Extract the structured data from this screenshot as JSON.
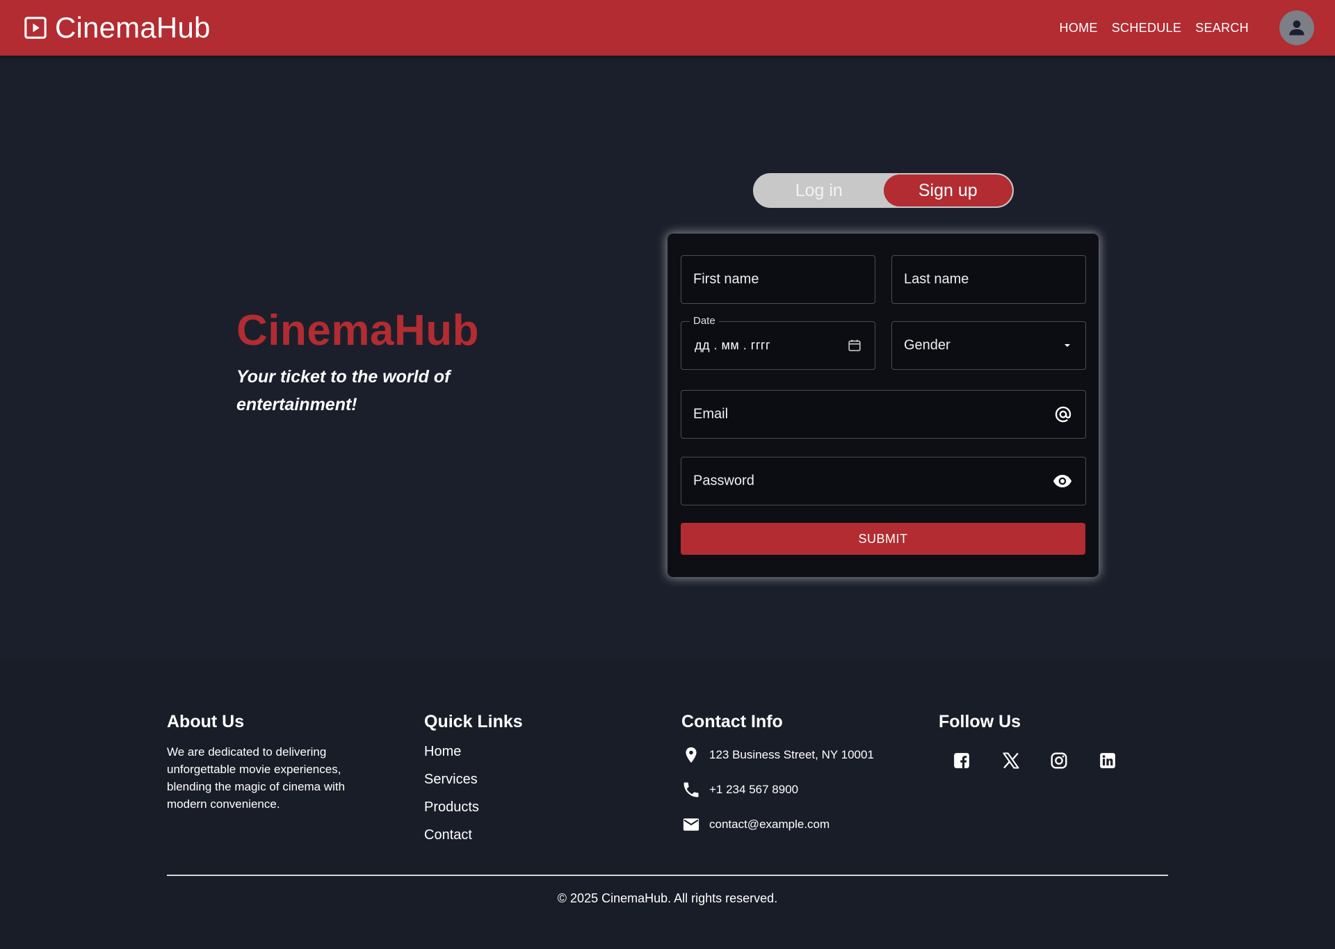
{
  "header": {
    "brand": "CinemaHub",
    "nav": [
      "HOME",
      "SCHEDULE",
      "SEARCH"
    ]
  },
  "hero": {
    "title": "CinemaHub",
    "tagline": "Your ticket to the world of entertainment!"
  },
  "auth_toggle": {
    "login": "Log in",
    "signup": "Sign up",
    "active": "signup"
  },
  "form": {
    "first_name": "First name",
    "last_name": "Last name",
    "date_label": "Date",
    "date_value": "дд . мм . гггг",
    "gender": "Gender",
    "email": "Email",
    "password": "Password",
    "submit": "SUBMIT"
  },
  "footer": {
    "about": {
      "heading": "About Us",
      "text": "We are dedicated to delivering unforgettable movie experiences, blending the magic of cinema with modern convenience."
    },
    "quick_links": {
      "heading": "Quick Links",
      "items": [
        "Home",
        "Services",
        "Products",
        "Contact"
      ]
    },
    "contact": {
      "heading": "Contact Info",
      "address": "123 Business Street, NY 10001",
      "phone": "+1 234 567 8900",
      "email": "contact@example.com"
    },
    "follow": {
      "heading": "Follow Us",
      "icons": [
        "facebook-icon",
        "x-icon",
        "instagram-icon",
        "linkedin-icon"
      ]
    },
    "copyright": "© 2025 CinemaHub. All rights reserved."
  },
  "colors": {
    "accent": "#b22c32",
    "background": "#1b1f2b",
    "card": "#0d0f15",
    "footer": "#191d27"
  }
}
